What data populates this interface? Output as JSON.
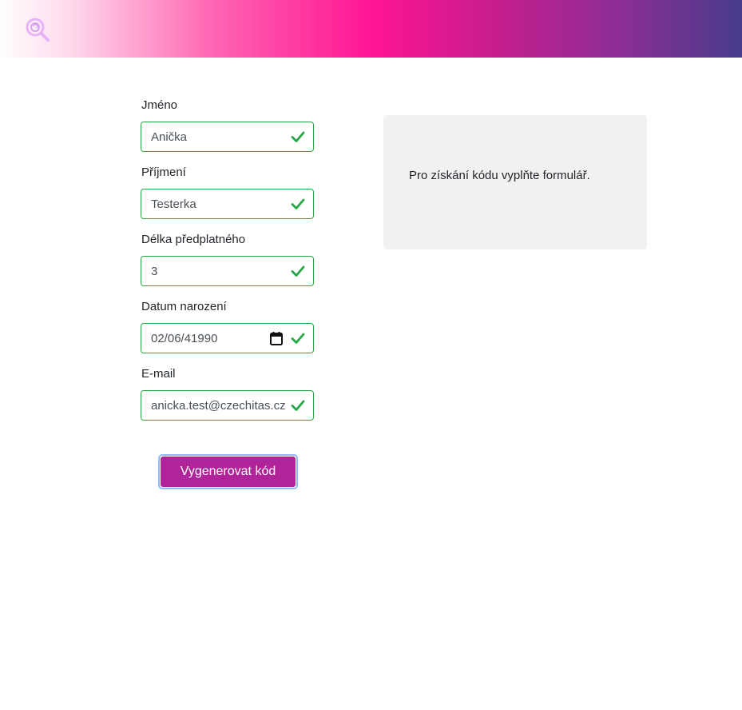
{
  "header": {
    "logo_icon": "magnifier-logo-icon",
    "gradient_colors": [
      "#ffffff",
      "#ff1493",
      "#473c8b"
    ]
  },
  "form": {
    "fields": [
      {
        "label": "Jméno",
        "value": "Anička",
        "valid": true
      },
      {
        "label": "Příjmení",
        "value": "Testerka",
        "valid": true
      },
      {
        "label": "Délka předplatného",
        "value": "3",
        "valid": true
      },
      {
        "label": "Datum narození",
        "value": "02/06/41990",
        "valid": true,
        "icon": "calendar-icon"
      },
      {
        "label": "E-mail",
        "value": "anicka.test@czechitas.cz",
        "valid": true
      }
    ],
    "submit_label": "Vygenerovat kód"
  },
  "result": {
    "text": "Pro získání kódu vyplňte formulář."
  },
  "colors": {
    "valid": "#28a745",
    "button": "#b0249a",
    "focus_ring": "#8fb8ff",
    "result_bg": "#f1f1f1"
  }
}
